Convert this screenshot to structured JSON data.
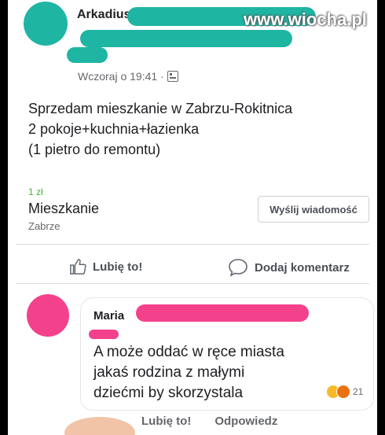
{
  "post": {
    "author": "Arkadiusz",
    "timestamp": "Wczoraj o 19:41",
    "separator": "·",
    "text_lines": [
      "Sprzedam mieszkanie w Zabrzu-Rokitnica",
      "2 pokoje+kuchnia+łazienka",
      "(1 pietro do remontu)"
    ],
    "price": "1 zł",
    "item_title": "Mieszkanie",
    "item_location": "Zabrze",
    "message_button": "Wyślij wiadomość"
  },
  "actions": {
    "like": "Lubię to!",
    "comment": "Dodaj komentarz"
  },
  "comment": {
    "author": "Maria",
    "text_lines": [
      "A może oddać w ręce miasta",
      "jakaś rodzina z małymi",
      "dziećmi by skorzystala"
    ],
    "reaction_count": "21",
    "like_action": "Lubię to!",
    "reply_action": "Odpowiedz"
  },
  "watermark": "www.wiocha.pl",
  "colors": {
    "redaction_teal": "#1fb5a3",
    "redaction_pink": "#f4418c",
    "price_green": "#42b72a"
  },
  "icons": {
    "audience": "privacy-icon",
    "like": "thumbs-up-icon",
    "comment": "speech-bubble-icon",
    "reactions": [
      "haha-icon",
      "angry-icon"
    ]
  }
}
